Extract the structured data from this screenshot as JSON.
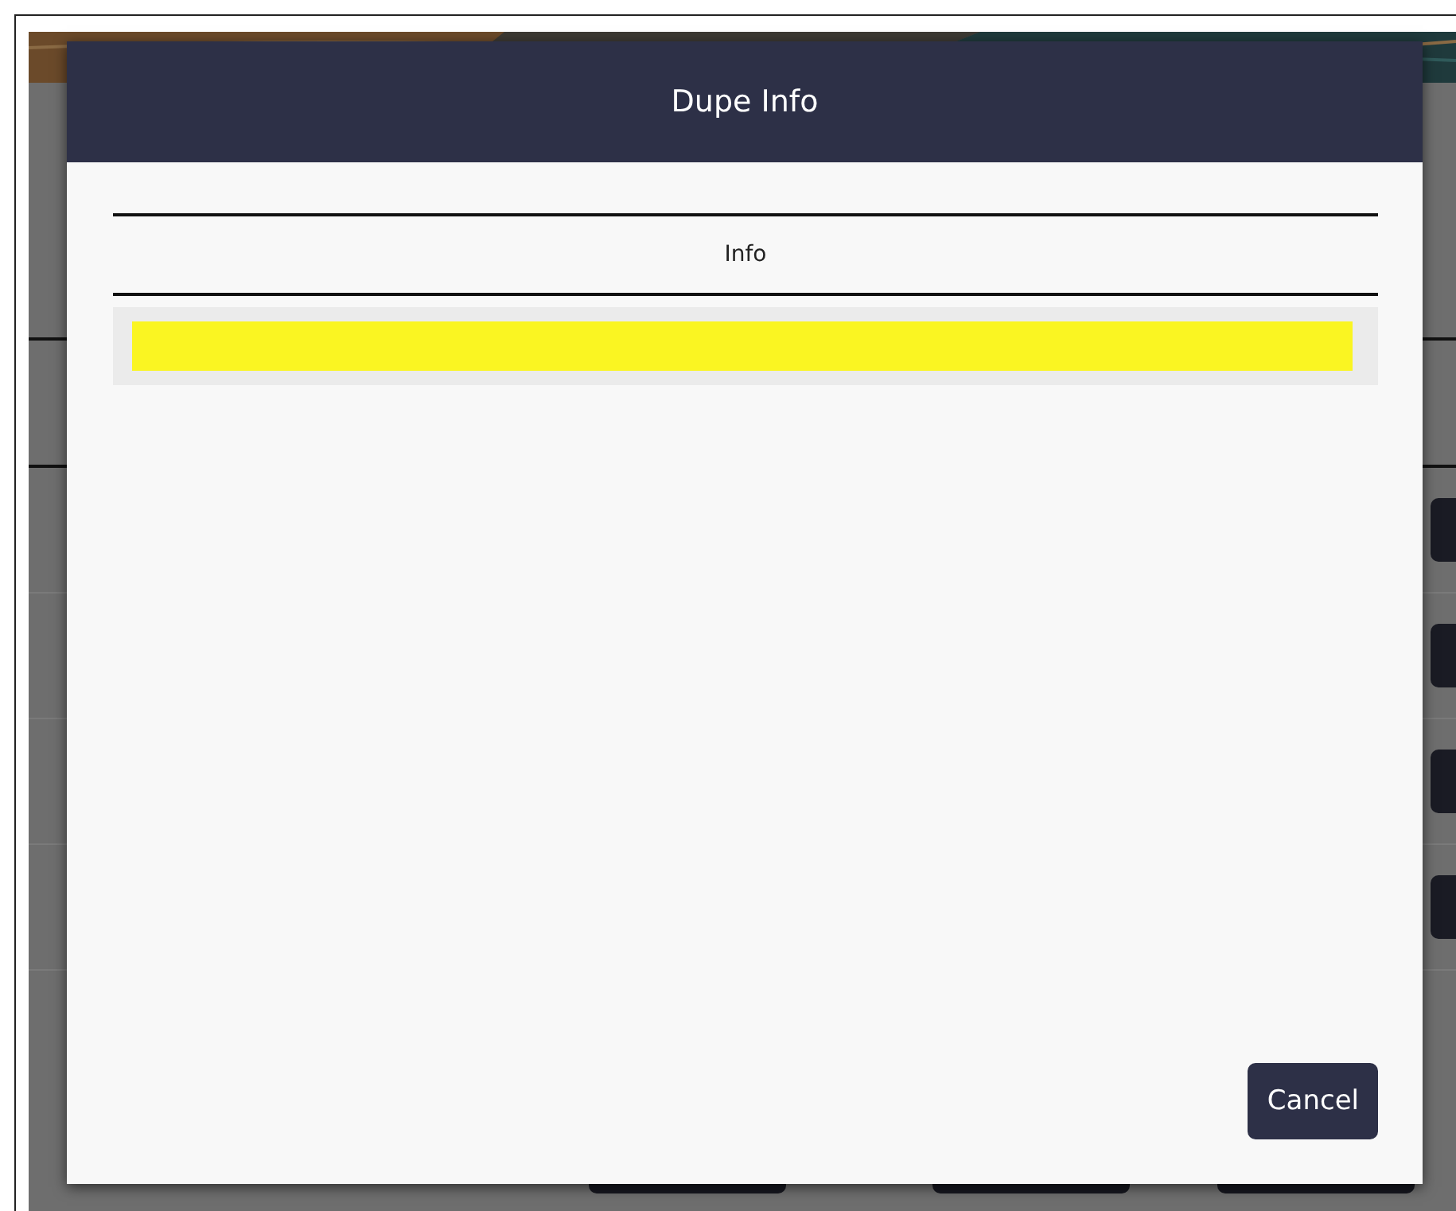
{
  "dialog": {
    "title": "Dupe Info",
    "table": {
      "columns": [
        "Info"
      ],
      "rows": [
        {
          "highlighted": true
        }
      ]
    },
    "buttons": [
      "Cancel"
    ]
  }
}
